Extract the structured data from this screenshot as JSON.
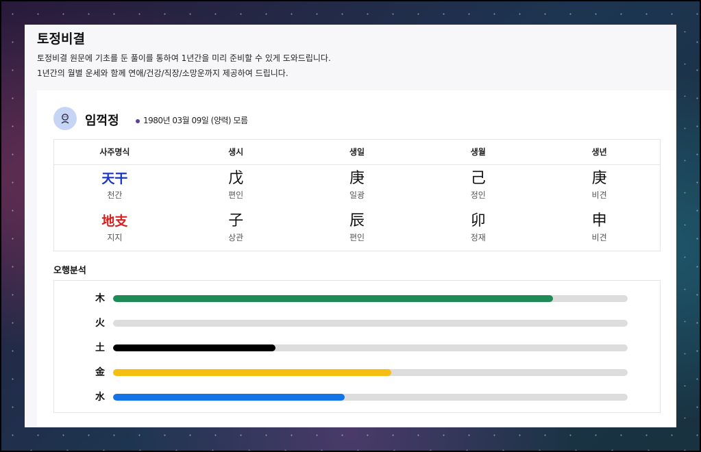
{
  "page": {
    "title": "토정비결",
    "description_1": "토정비결 원문에 기초를 둔 풀이를 통하여 1년간을 미리 준비할 수 있게 도와드립니다.",
    "description_2": "1년간의 월별 운세와 함께 연애/건강/직장/소망운까지 제공하여 드립니다."
  },
  "profile": {
    "avatar_icon": "person-icon",
    "name": "임꺽정",
    "birth_info": "1980년 03월 09일 (양력) 모름"
  },
  "saju": {
    "headers": [
      "사주명식",
      "생시",
      "생일",
      "생월",
      "생년"
    ],
    "cheongan": {
      "label": "天干",
      "label_sub": "천간",
      "label_color": "#1a35c9",
      "cells": [
        {
          "char": "戊",
          "sub": "편인"
        },
        {
          "char": "庚",
          "sub": "일광"
        },
        {
          "char": "己",
          "sub": "정인"
        },
        {
          "char": "庚",
          "sub": "비견"
        }
      ]
    },
    "jiji": {
      "label": "地支",
      "label_sub": "지지",
      "label_color": "#d91e1e",
      "cells": [
        {
          "char": "子",
          "sub": "상관"
        },
        {
          "char": "辰",
          "sub": "편인"
        },
        {
          "char": "卯",
          "sub": "정재"
        },
        {
          "char": "申",
          "sub": "비견"
        }
      ]
    }
  },
  "ohang": {
    "title": "오행분석",
    "elements": [
      {
        "label": "木",
        "level": 0.855,
        "color": "#1e8a55"
      },
      {
        "label": "火",
        "level": 0.0,
        "color": "#e04a3a"
      },
      {
        "label": "土",
        "level": 0.315,
        "color": "#000000"
      },
      {
        "label": "金",
        "level": 0.54,
        "color": "#f5be12"
      },
      {
        "label": "水",
        "level": 0.45,
        "color": "#1473e6"
      }
    ]
  }
}
